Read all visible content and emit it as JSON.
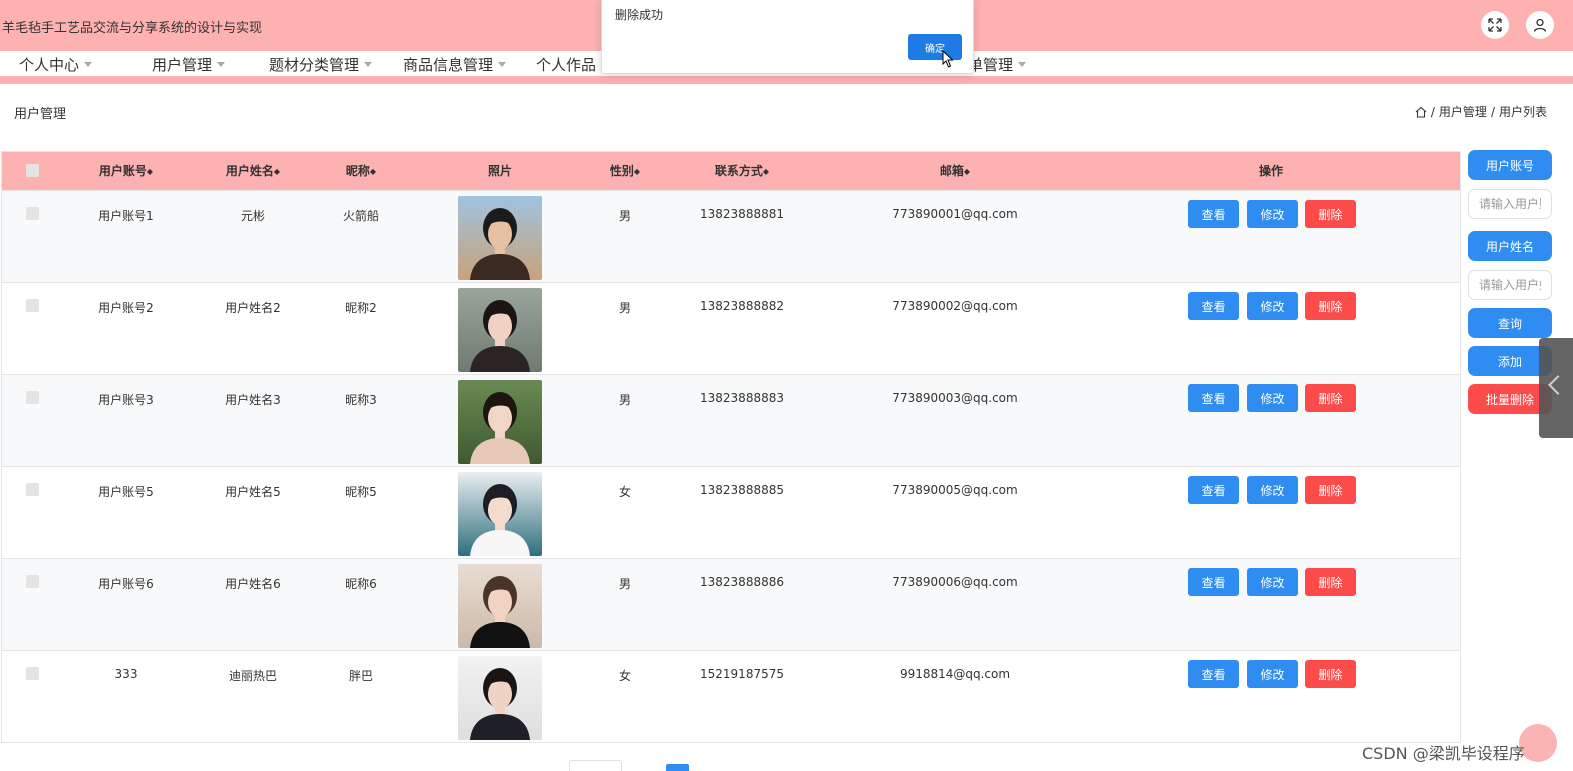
{
  "app": {
    "title": "羊毛毡手工艺品交流与分享系统的设计与实现"
  },
  "nav": {
    "items": [
      {
        "label": "个人中心"
      },
      {
        "label": "用户管理"
      },
      {
        "label": "题材分类管理"
      },
      {
        "label": "商品信息管理"
      },
      {
        "label": "个人作品"
      },
      {
        "label": "单管理"
      }
    ]
  },
  "page": {
    "title": "用户管理",
    "breadcrumb": [
      "用户管理",
      "用户列表"
    ],
    "breadcrumb_sep": "/"
  },
  "table": {
    "headers": {
      "account": "用户账号",
      "name": "用户姓名",
      "nickname": "昵称",
      "photo": "照片",
      "gender": "性别",
      "phone": "联系方式",
      "email": "邮箱",
      "actions": "操作"
    },
    "sort_glyph": "◆",
    "rows": [
      {
        "account": "用户账号1",
        "name": "元彬",
        "nickname": "火箭船",
        "gender": "男",
        "phone": "13823888881",
        "email": "773890001@qq.com"
      },
      {
        "account": "用户账号2",
        "name": "用户姓名2",
        "nickname": "昵称2",
        "gender": "男",
        "phone": "13823888882",
        "email": "773890002@qq.com"
      },
      {
        "account": "用户账号3",
        "name": "用户姓名3",
        "nickname": "昵称3",
        "gender": "男",
        "phone": "13823888883",
        "email": "773890003@qq.com"
      },
      {
        "account": "用户账号5",
        "name": "用户姓名5",
        "nickname": "昵称5",
        "gender": "女",
        "phone": "13823888885",
        "email": "773890005@qq.com"
      },
      {
        "account": "用户账号6",
        "name": "用户姓名6",
        "nickname": "昵称6",
        "gender": "男",
        "phone": "13823888886",
        "email": "773890006@qq.com"
      },
      {
        "account": "333",
        "name": "迪丽热巴",
        "nickname": "胖巴",
        "gender": "女",
        "phone": "15219187575",
        "email": "9918814@qq.com"
      }
    ],
    "actions": {
      "view": "查看",
      "edit": "修改",
      "delete": "删除"
    }
  },
  "search": {
    "account_label": "用户账号",
    "account_placeholder": "请输入用户账号",
    "name_label": "用户姓名",
    "name_placeholder": "请输入用户姓名",
    "query": "查询",
    "add": "添加",
    "batch_delete": "批量删除"
  },
  "modal": {
    "message": "删除成功",
    "ok": "确定"
  },
  "watermark": "CSDN @梁凯毕设程序",
  "colors": {
    "header_pink": "#fdb1b1",
    "primary_blue": "#2f8cf0",
    "danger_red": "#fb4b4b"
  }
}
